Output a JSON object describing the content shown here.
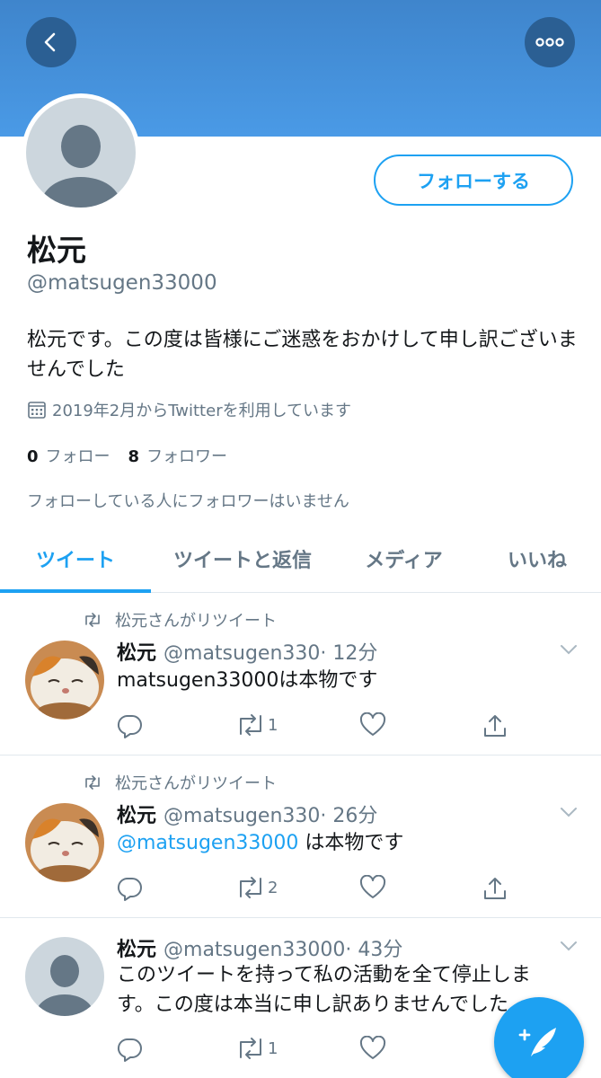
{
  "header": {
    "back_icon": "chevron-left-icon",
    "more_icon": "more-horizontal-icon",
    "banner_color": "#4a94de"
  },
  "profile": {
    "follow_label": "フォローする",
    "name": "松元",
    "handle": "@matsugen33000",
    "bio": "松元です。この度は皆様にご迷惑をおかけして申し訳ございませんでした",
    "joined": "2019年2月からTwitterを利用しています",
    "following_count": "0",
    "following_label": "フォロー",
    "followers_count": "8",
    "followers_label": "フォロワー",
    "known_followers": "フォローしている人にフォロワーはいません"
  },
  "tabs": [
    {
      "label": "ツイート",
      "active": true
    },
    {
      "label": "ツイートと返信",
      "active": false
    },
    {
      "label": "メディア",
      "active": false
    },
    {
      "label": "いいね",
      "active": false
    }
  ],
  "tweets": [
    {
      "retweet_label": "松元さんがリツイート",
      "name": "松元",
      "handle": "@matsugen330",
      "time": "· 12分",
      "text_link": "",
      "text": "matsugen33000は本物です",
      "retweets": "1"
    },
    {
      "retweet_label": "松元さんがリツイート",
      "name": "松元",
      "handle": "@matsugen330",
      "time": "· 26分",
      "text_link": "@matsugen33000",
      "text": " は本物です",
      "retweets": "2"
    },
    {
      "retweet_label": "",
      "name": "松元",
      "handle": "@matsugen33000",
      "time": "· 43分",
      "text_link": "",
      "text": "このツイートを持って私の活動を全て停止します。この度は本当に申し訳ありませんでした",
      "retweets": "1"
    }
  ],
  "colors": {
    "accent": "#1da1f2",
    "secondary_text": "#657786"
  },
  "compose_icon": "compose-feather-icon"
}
